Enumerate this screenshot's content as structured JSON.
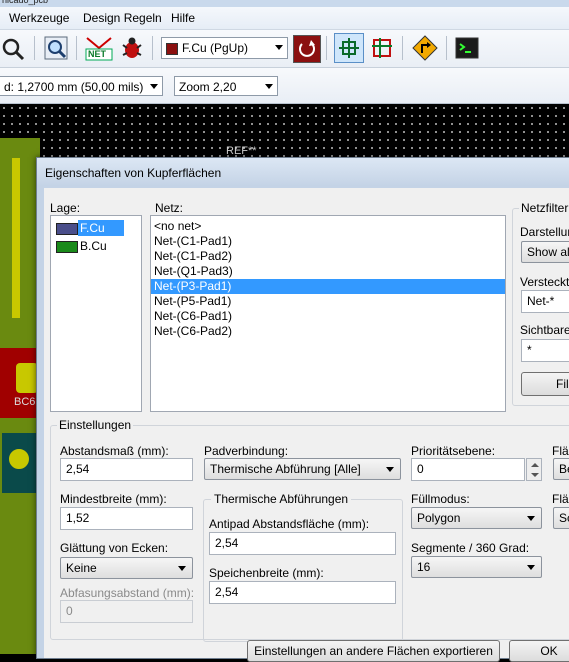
{
  "window": {
    "title_fragment": "nicado_pcb"
  },
  "menu": [
    "Werkzeuge",
    "Design Regeln",
    "Hilfe"
  ],
  "toolbar": {
    "layer_select": "F.Cu (PgUp)",
    "layer_color": "#8b1010",
    "track_width_select": "d: 1,2700 mm (50,00 mils)",
    "zoom_select": "Zoom 2,20",
    "net_icon_label": "NET"
  },
  "canvas": {
    "ref_label": "REF**",
    "component_label": "BC6"
  },
  "dialog": {
    "title": "Eigenschaften von Kupferflächen",
    "lage_label": "Lage:",
    "layers": [
      {
        "name": "F.Cu",
        "color": "#4a4e8a",
        "selected": true
      },
      {
        "name": "B.Cu",
        "color": "#1a8a1a",
        "selected": false
      }
    ],
    "netz_label": "Netz:",
    "nets": [
      "<no net>",
      "Net-(C1-Pad1)",
      "Net-(C1-Pad2)",
      "Net-(Q1-Pad3)",
      "Net-(P3-Pad1)",
      "Net-(P5-Pad1)",
      "Net-(C6-Pad1)",
      "Net-(C6-Pad2)"
    ],
    "selected_net_index": 4,
    "netzfilter": {
      "title": "Netzfilter",
      "display_label": "Darstellun",
      "display_value": "Show all",
      "hidden_label": "Versteckte",
      "hidden_value": "Net-*",
      "visible_label": "Sichtbare",
      "visible_value": "*",
      "filter_button": "Fil"
    },
    "settings": {
      "title": "Einstellungen",
      "clearance_label": "Abstandsmaß (mm):",
      "clearance_value": "2,54",
      "min_width_label": "Mindestbreite (mm):",
      "min_width_value": "1,52",
      "smoothing_label": "Glättung von Ecken:",
      "smoothing_value": "Keine",
      "chamfer_label": "Abfasungsabstand (mm):",
      "chamfer_value": "0",
      "pad_conn_label": "Padverbindung:",
      "pad_conn_value": "Thermische Abführung [Alle]",
      "thermal_group_title": "Thermische Abführungen",
      "antipad_label": "Antipad Abstandsfläche (mm):",
      "antipad_value": "2,54",
      "spoke_label": "Speichenbreite (mm):",
      "spoke_value": "2,54",
      "priority_label": "Prioritätsebene:",
      "priority_value": "0",
      "fill_mode_label": "Füllmodus:",
      "fill_mode_value": "Polygon",
      "segments_label": "Segmente / 360 Grad:",
      "segments_value": "16",
      "flae_label_1": "Fläc",
      "flae_value_1": "Be",
      "flae_label_2": "Fläc",
      "flae_value_2": "Sc"
    },
    "export_button": "Einstellungen an andere Flächen exportieren",
    "ok_button": "OK"
  }
}
